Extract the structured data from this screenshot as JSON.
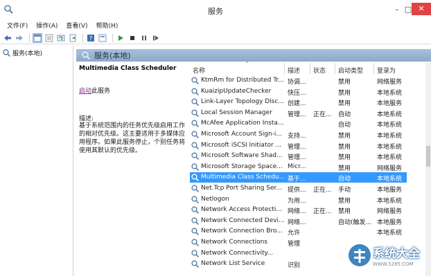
{
  "window": {
    "title": "服务",
    "min_label": "–",
    "max_label": "□",
    "close_label": "✕"
  },
  "menu": [
    {
      "label": "文件(F)"
    },
    {
      "label": "操作(A)"
    },
    {
      "label": "查看(V)"
    },
    {
      "label": "帮助(H)"
    }
  ],
  "toolbar": {
    "icons": [
      "back-arrow-icon",
      "forward-arrow-icon",
      "console-tree-icon",
      "list-view-icon",
      "refresh-icon",
      "export-icon",
      "help-icon",
      "properties-icon",
      "play-icon",
      "stop-icon",
      "pause-icon",
      "restart-icon"
    ]
  },
  "tree": {
    "item_label": "服务(本地)"
  },
  "pane": {
    "header_label": "服务(本地)"
  },
  "description": {
    "service_name": "Multimedia Class Scheduler",
    "action_link": "启动",
    "action_suffix": "此服务",
    "label": "描述:",
    "body": "基于系统范围内的任务优先级启用工作的相对优先级。这主要适用于多媒体应用程序。如果此服务停止，个别任务将使用其默认的优先级。"
  },
  "columns": {
    "name": "名称",
    "desc": "描述",
    "status": "状态",
    "startup": "启动类型",
    "logon": "登录为"
  },
  "rows": [
    {
      "name": "KtmRm for Distributed Tr...",
      "desc": "协调...",
      "status": "",
      "startup": "禁用",
      "logon": "网络服务"
    },
    {
      "name": "KuaizipUpdateChecker",
      "desc": "快压...",
      "status": "",
      "startup": "禁用",
      "logon": "本地系统"
    },
    {
      "name": "Link-Layer Topology Disc...",
      "desc": "创建...",
      "status": "",
      "startup": "禁用",
      "logon": "本地服务"
    },
    {
      "name": "Local Session Manager",
      "desc": "管理...",
      "status": "正在...",
      "startup": "自动",
      "logon": "本地系统"
    },
    {
      "name": "McAfee Application Insta...",
      "desc": "",
      "status": "",
      "startup": "自动",
      "logon": "本地系统"
    },
    {
      "name": "Microsoft Account Sign-i...",
      "desc": "支持...",
      "status": "",
      "startup": "禁用",
      "logon": "本地系统"
    },
    {
      "name": "Microsoft iSCSI Initiator ...",
      "desc": "管理...",
      "status": "",
      "startup": "禁用",
      "logon": "本地系统"
    },
    {
      "name": "Microsoft Software Shad...",
      "desc": "管理...",
      "status": "",
      "startup": "禁用",
      "logon": "本地系统"
    },
    {
      "name": "Microsoft Storage Space...",
      "desc": "Micr...",
      "status": "",
      "startup": "禁用",
      "logon": "网络服务"
    },
    {
      "name": "Multimedia Class Schedu...",
      "desc": "基于...",
      "status": "",
      "startup": "自动",
      "logon": "本地系统",
      "selected": true
    },
    {
      "name": "Net.Tcp Port Sharing Ser...",
      "desc": "提供...",
      "status": "正在...",
      "startup": "手动",
      "logon": "本地服务"
    },
    {
      "name": "Netlogon",
      "desc": "为用...",
      "status": "",
      "startup": "禁用",
      "logon": "本地系统"
    },
    {
      "name": "Network Access Protecti...",
      "desc": "网络...",
      "status": "正在...",
      "startup": "禁用",
      "logon": "网络服务"
    },
    {
      "name": "Network Connected Devi...",
      "desc": "网络...",
      "status": "",
      "startup": "自动(触发...",
      "logon": "本地服务"
    },
    {
      "name": "Network Connection Bro...",
      "desc": "允许",
      "status": "",
      "startup": "",
      "logon": "本地系统"
    },
    {
      "name": "Network Connections",
      "desc": "管理",
      "status": "",
      "startup": "",
      "logon": ""
    },
    {
      "name": "Network Connectivity...",
      "desc": "",
      "status": "",
      "startup": "",
      "logon": ""
    },
    {
      "name": "Network List Service",
      "desc": "识别",
      "status": "",
      "startup": "",
      "logon": ""
    }
  ],
  "watermark": {
    "text": "系统大全",
    "url": "WWW.5285.COM"
  },
  "colors": {
    "selection": "#3399ff",
    "pane_header": "#8eaacb",
    "close_button": "#e04343",
    "link": "#8c2a8c"
  }
}
